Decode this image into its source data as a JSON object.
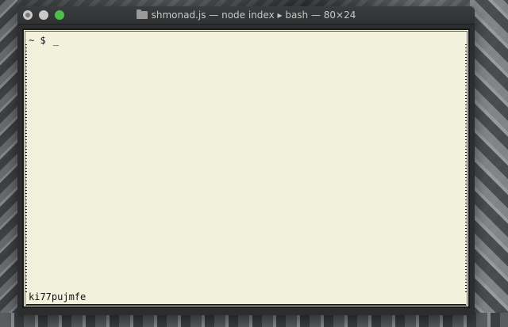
{
  "window": {
    "title": "shmonad.js — node index ▸ bash — 80×24",
    "title_icon": "folder-icon",
    "buttons": [
      "close",
      "minimize",
      "zoom"
    ]
  },
  "terminal": {
    "prompt": "~ $",
    "cursor": "_",
    "status_text": "ki77pujmfe",
    "background_color": "#f2f2dc",
    "text_color": "#111111"
  },
  "colors": {
    "zoom_button": "#4cc04a",
    "titlebar": "#2f3133"
  }
}
